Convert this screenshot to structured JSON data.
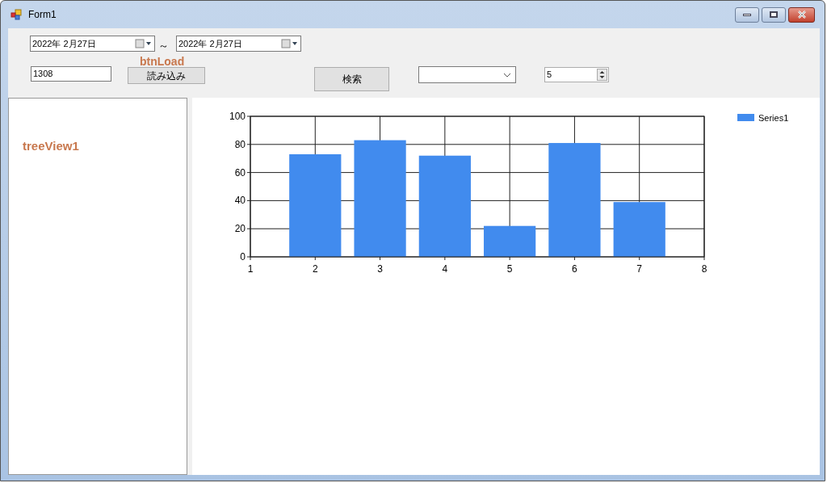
{
  "window": {
    "title": "Form1"
  },
  "date_from": {
    "value": "2022年  2月27日"
  },
  "range_separator": "～",
  "date_to": {
    "value": "2022年  2月27日"
  },
  "load_annotation": "btnLoad",
  "code_field": {
    "value": "1308"
  },
  "load_button": {
    "label": "読み込み"
  },
  "search_button": {
    "label": "検索"
  },
  "spin_box": {
    "value": "5"
  },
  "tree_view": {
    "annotation": "treeView1"
  },
  "chart": {
    "chart_data": {
      "type": "bar",
      "grid": true,
      "x": [
        2,
        3,
        4,
        5,
        6,
        7
      ],
      "xlim": [
        1,
        8
      ],
      "ylim": [
        0,
        100
      ],
      "xticks": [
        1,
        2,
        3,
        4,
        5,
        6,
        7,
        8
      ],
      "yticks": [
        0,
        20,
        40,
        60,
        80,
        100
      ],
      "series": [
        {
          "name": "Series1",
          "color": "#418bee",
          "values": [
            73,
            83,
            72,
            22,
            81,
            39
          ]
        }
      ]
    }
  }
}
